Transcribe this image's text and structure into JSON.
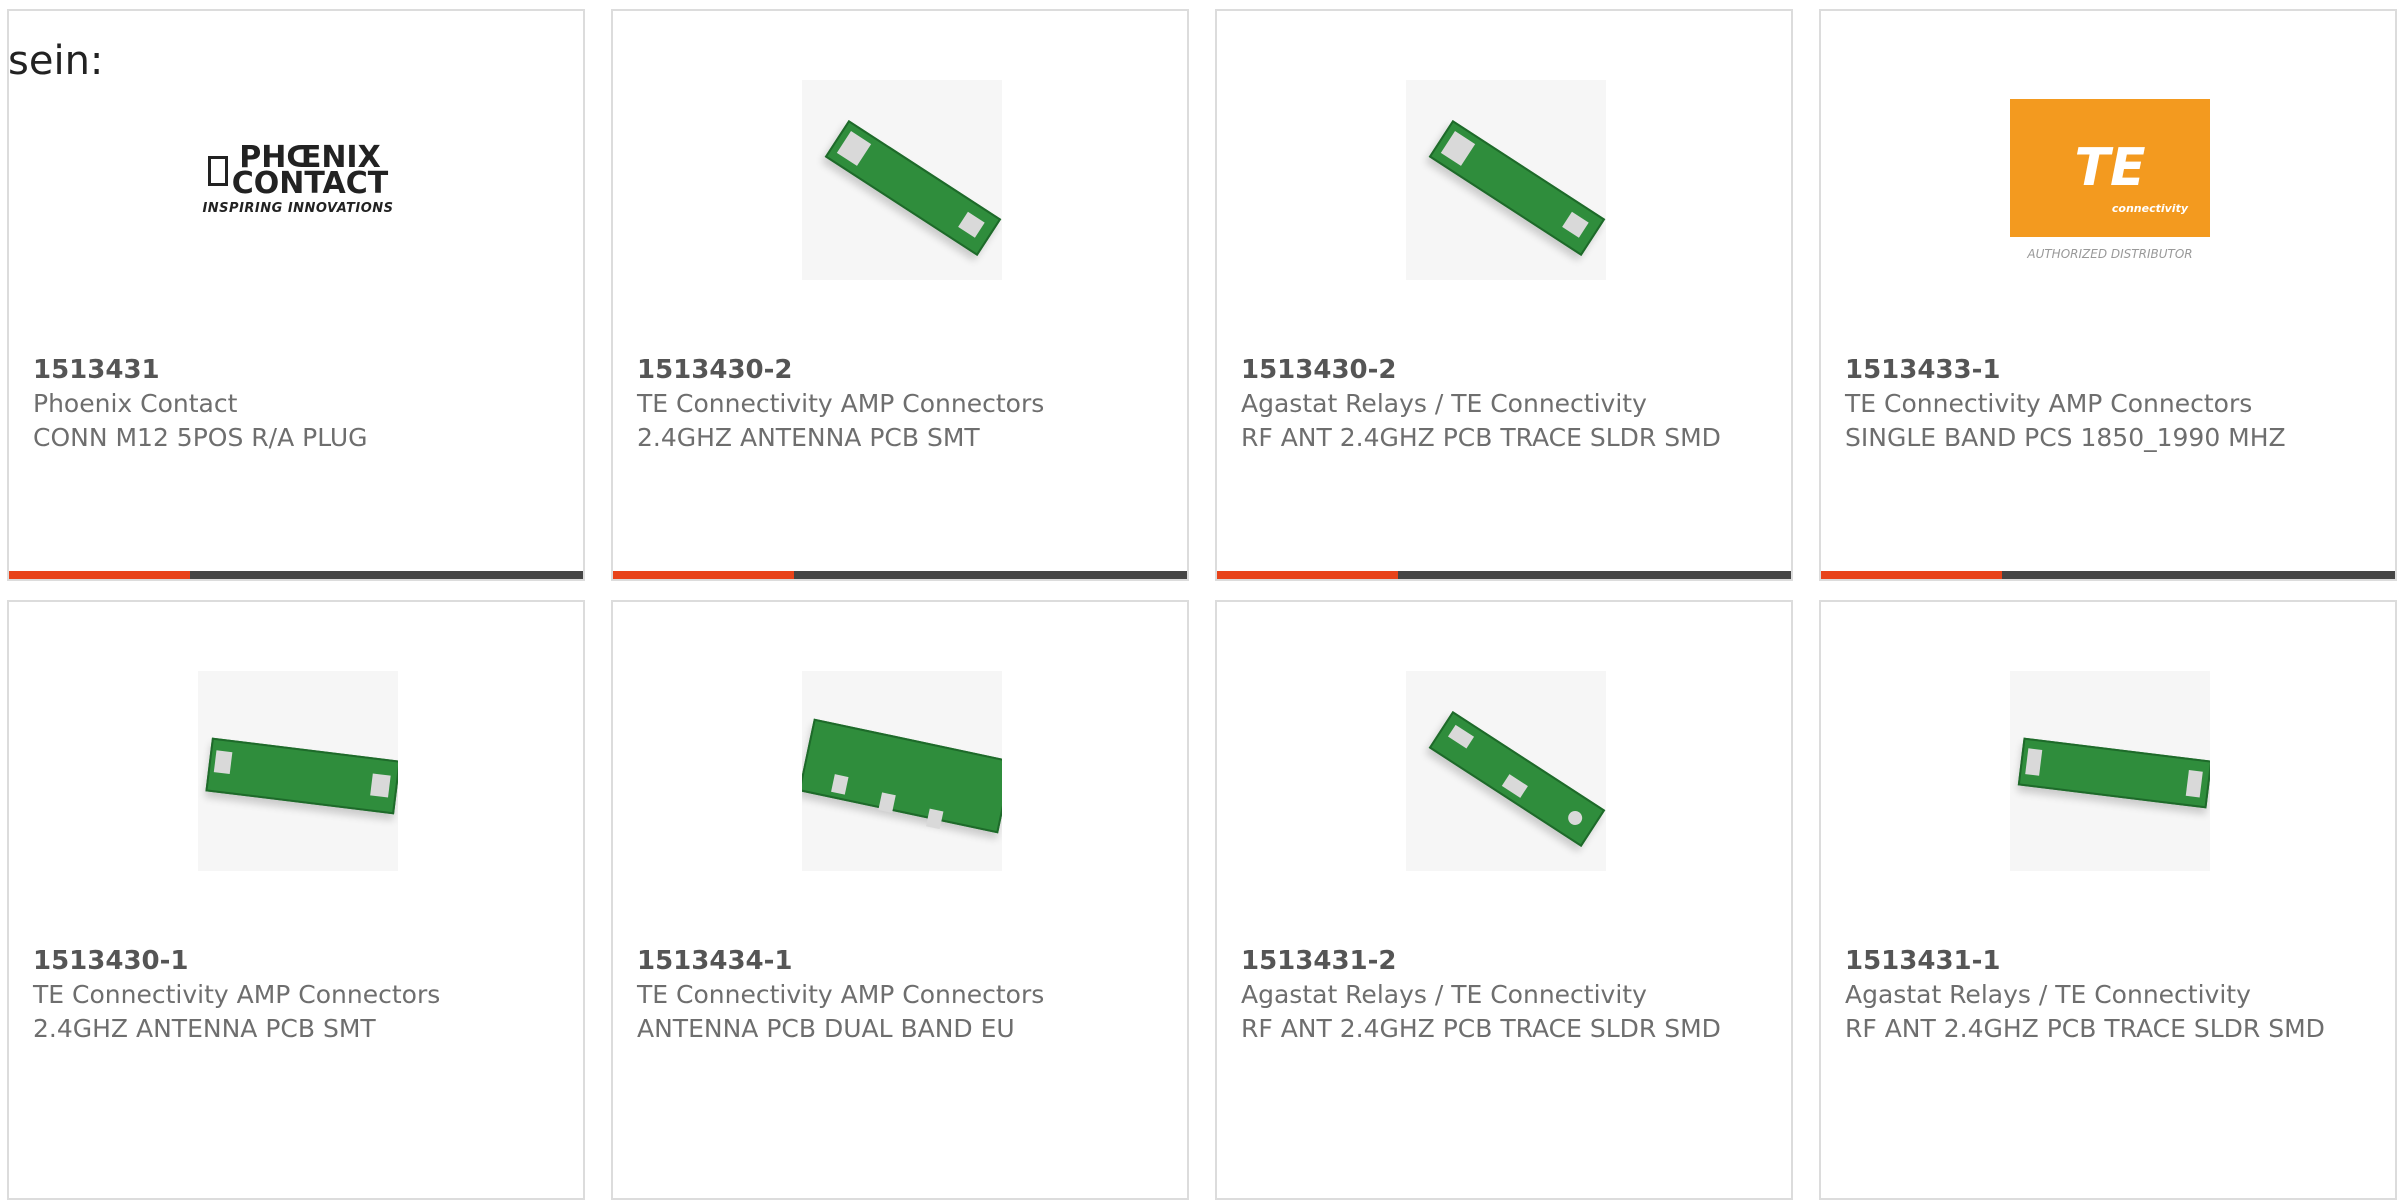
{
  "intro_text": "sein:",
  "colors": {
    "accent": "#e8431a",
    "bar": "#444444",
    "border": "#dcdcdc",
    "te_orange": "#f39a1f"
  },
  "cards": [
    {
      "part": "1513431",
      "maker": "Phoenix Contact",
      "desc": "CONN M12 5POS R/A PLUG",
      "image": "phoenix-contact-logo",
      "logo_top": "PHŒNIX",
      "logo_mid": "CONTACT",
      "logo_tag": "INSPIRING INNOVATIONS"
    },
    {
      "part": "1513430-2",
      "maker": "TE Connectivity AMP Connectors",
      "desc": "2.4GHZ ANTENNA PCB SMT",
      "image": "pcb-antenna"
    },
    {
      "part": "1513430-2",
      "maker": "Agastat Relays / TE Connectivity",
      "desc": "RF ANT 2.4GHZ PCB TRACE SLDR SMD",
      "image": "pcb-antenna"
    },
    {
      "part": "1513433-1",
      "maker": "TE Connectivity AMP Connectors",
      "desc": "SINGLE BAND PCS 1850_1990 MHZ",
      "image": "te-connectivity-logo",
      "logo_main": "TE",
      "logo_sub": "connectivity",
      "logo_caption": "AUTHORIZED DISTRIBUTOR"
    },
    {
      "part": "1513430-1",
      "maker": "TE Connectivity AMP Connectors",
      "desc": "2.4GHZ ANTENNA PCB SMT",
      "image": "pcb-antenna"
    },
    {
      "part": "1513434-1",
      "maker": "TE Connectivity AMP Connectors",
      "desc": "ANTENNA PCB DUAL BAND EU",
      "image": "pcb-antenna"
    },
    {
      "part": "1513431-2",
      "maker": "Agastat Relays / TE Connectivity",
      "desc": "RF ANT 2.4GHZ PCB TRACE SLDR SMD",
      "image": "pcb-antenna"
    },
    {
      "part": "1513431-1",
      "maker": "Agastat Relays / TE Connectivity",
      "desc": "RF ANT 2.4GHZ PCB TRACE SLDR SMD",
      "image": "pcb-antenna"
    }
  ]
}
